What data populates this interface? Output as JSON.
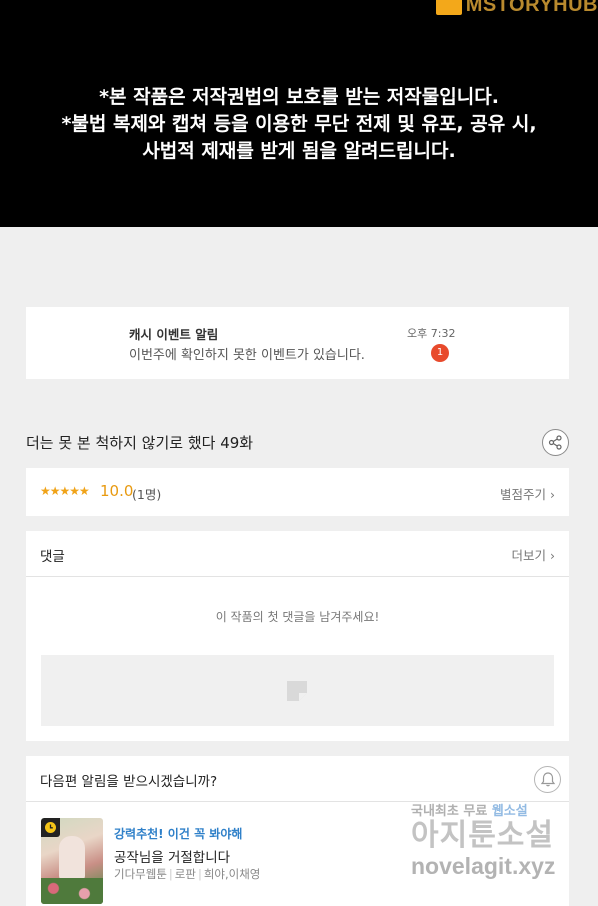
{
  "banner": {
    "brand": "MSTORYHUB",
    "notice_lines": [
      "*본 작품은 저작권법의 보호를 받는 저작물입니다.",
      "*불법 복제와 캡쳐 등을 이용한 무단 전제 및 유포, 공유 시,",
      "사법적 제재를 받게 됨을 알려드립니다."
    ]
  },
  "alarm": {
    "title": "캐시 이벤트 알림",
    "message": "이번주에 확인하지 못한 이벤트가 있습니다.",
    "time": "오후 7:32",
    "badge": "1"
  },
  "episode": {
    "title": "더는 못 본 척하지 않기로 했다 49화",
    "share_icon": "share-icon"
  },
  "rating": {
    "stars": "★★★★★",
    "score": "10.0",
    "count": "(1명)",
    "rate_label": "별점주기 ›"
  },
  "comments": {
    "label": "댓글",
    "more": "더보기 ›",
    "empty": "이 작품의 첫 댓글을 남겨주세요!"
  },
  "next": {
    "question": "다음편 알림을 받으시겠습니까?",
    "bell_icon": "bell-icon",
    "promo": "강력추천! 이건 꼭 봐야해",
    "work_title": "공작님을 거절합니다",
    "genre": "기다무웹툰",
    "category": "로판",
    "authors": "희야,이채영"
  },
  "watermark": {
    "top_a": "국내최초 무료",
    "top_b": "웹소설",
    "mid": "아지툰소설",
    "bottom": "novelagit.xyz"
  },
  "colors": {
    "accent_orange": "#e89a10",
    "badge_red": "#e84a2c",
    "promo_blue": "#2f80c9"
  }
}
